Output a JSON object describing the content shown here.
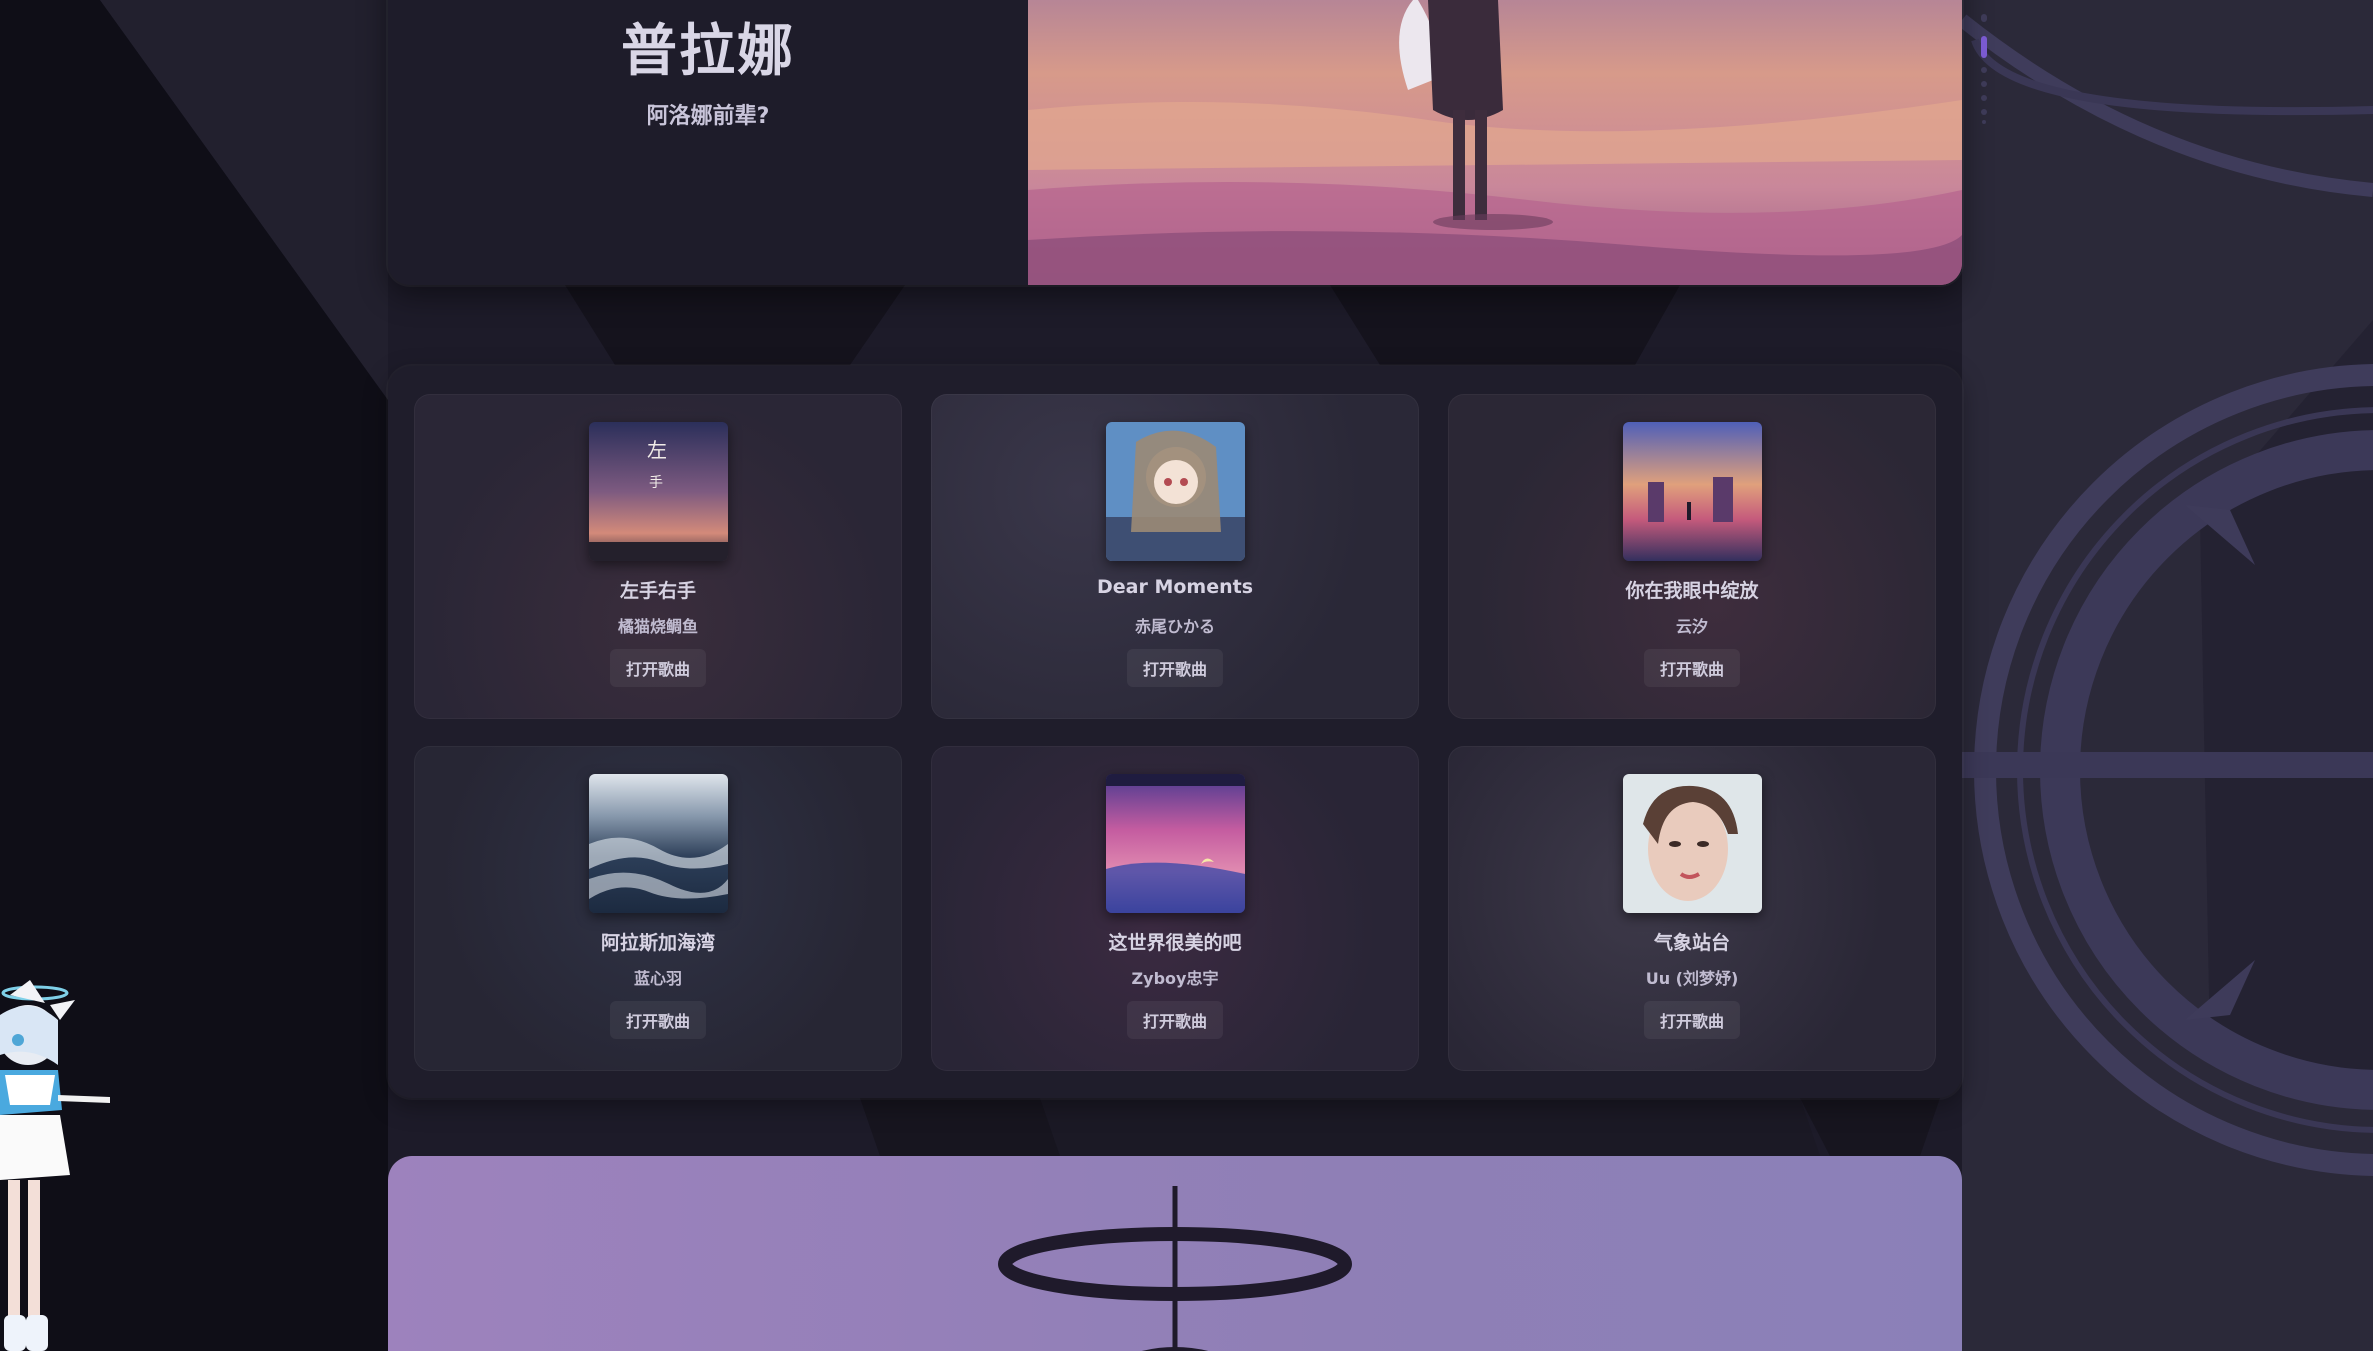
{
  "hero": {
    "title": "普拉娜",
    "subtitle": "阿洛娜前辈?"
  },
  "songs": [
    {
      "title": "左手右手",
      "artist": "橘猫烧鲷鱼",
      "button": "打开歌曲"
    },
    {
      "title": "Dear Moments",
      "artist": "赤尾ひかる",
      "button": "打开歌曲"
    },
    {
      "title": "你在我眼中绽放",
      "artist": "云汐",
      "button": "打开歌曲"
    },
    {
      "title": "阿拉斯加海湾",
      "artist": "蓝心羽",
      "button": "打开歌曲"
    },
    {
      "title": "这世界很美的吧",
      "artist": "Zyboy忠宇",
      "button": "打开歌曲"
    },
    {
      "title": "气象站台",
      "artist": "Uu (刘梦妤)",
      "button": "打开歌曲"
    }
  ],
  "colors": {
    "background": "#1d1b29",
    "card": "#1f1d2b",
    "accent_purple": "#9d82bd",
    "text": "#d7d3e3"
  }
}
